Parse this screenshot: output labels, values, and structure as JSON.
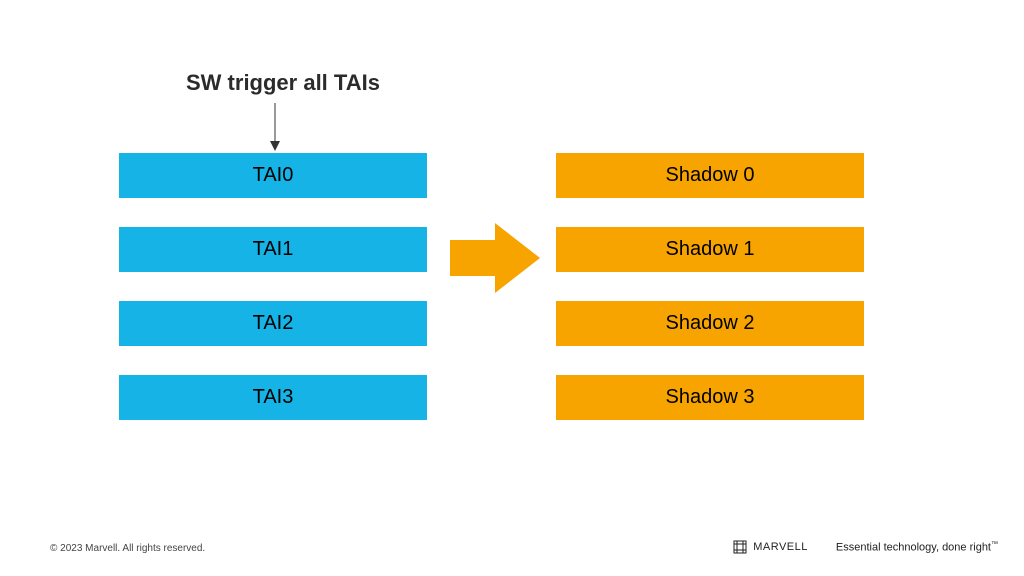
{
  "title": "SW trigger all TAIs",
  "left_blocks": [
    "TAI0",
    "TAI1",
    "TAI2",
    "TAI3"
  ],
  "right_blocks": [
    "Shadow 0",
    "Shadow 1",
    "Shadow 2",
    "Shadow 3"
  ],
  "colors": {
    "blue": "#15b3e6",
    "orange": "#f7a400"
  },
  "footer": {
    "copyright": "© 2023 Marvell. All rights reserved.",
    "brand": "MARVELL",
    "tagline": "Essential technology, done right",
    "tm": "™"
  }
}
